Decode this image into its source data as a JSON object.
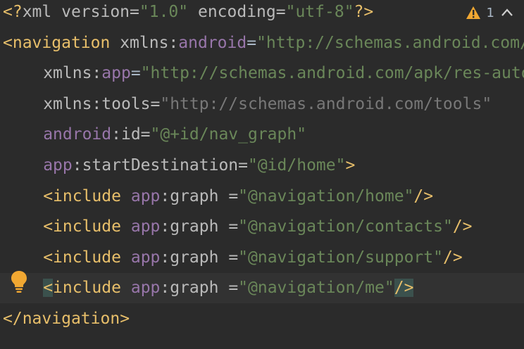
{
  "editor": {
    "lines": [
      {
        "id": "l1",
        "parts": [
          {
            "t": "<?",
            "c": "pi"
          },
          {
            "t": "xml version=",
            "c": "attr"
          },
          {
            "t": "\"1.0\"",
            "c": "val"
          },
          {
            "t": " encoding=",
            "c": "attr"
          },
          {
            "t": "\"utf-8\"",
            "c": "val"
          },
          {
            "t": "?>",
            "c": "pi"
          }
        ]
      },
      {
        "id": "l2",
        "parts": [
          {
            "t": "<",
            "c": "tag-bracket"
          },
          {
            "t": "navigation",
            "c": "tag-name"
          },
          {
            "t": " xmlns:",
            "c": "attr"
          },
          {
            "t": "android",
            "c": "ns"
          },
          {
            "t": "=",
            "c": "eq"
          },
          {
            "t": "\"http://schemas.android.com/apk/res/android\"",
            "c": "val"
          }
        ]
      },
      {
        "id": "l3",
        "indent": 2,
        "parts": [
          {
            "t": "xmlns:",
            "c": "attr"
          },
          {
            "t": "app",
            "c": "ns"
          },
          {
            "t": "=",
            "c": "eq"
          },
          {
            "t": "\"http://schemas.android.com/apk/res-auto\"",
            "c": "val"
          }
        ]
      },
      {
        "id": "l4",
        "indent": 2,
        "muted": true,
        "parts": [
          {
            "t": "xmlns:tools=",
            "c": "attr"
          },
          {
            "t": "\"http://schemas.android.com/tools\"",
            "c": "val"
          }
        ]
      },
      {
        "id": "l5",
        "indent": 2,
        "parts": [
          {
            "t": "android",
            "c": "ns"
          },
          {
            "t": ":id=",
            "c": "attr"
          },
          {
            "t": "\"@+id/nav_graph\"",
            "c": "val"
          }
        ]
      },
      {
        "id": "l6",
        "indent": 2,
        "parts": [
          {
            "t": "app",
            "c": "ns"
          },
          {
            "t": ":startDestination=",
            "c": "attr"
          },
          {
            "t": "\"@id/home\"",
            "c": "val"
          },
          {
            "t": ">",
            "c": "tag-bracket"
          }
        ]
      },
      {
        "id": "l7",
        "indent": 2,
        "parts": [
          {
            "t": "<",
            "c": "tag-bracket"
          },
          {
            "t": "include",
            "c": "tag-name"
          },
          {
            "t": " ",
            "c": "attr"
          },
          {
            "t": "app",
            "c": "ns"
          },
          {
            "t": ":graph =",
            "c": "attr"
          },
          {
            "t": "\"@navigation/home\"",
            "c": "val"
          },
          {
            "t": "/>",
            "c": "tag-bracket"
          }
        ]
      },
      {
        "id": "l8",
        "indent": 2,
        "parts": [
          {
            "t": "<",
            "c": "tag-bracket"
          },
          {
            "t": "include",
            "c": "tag-name"
          },
          {
            "t": " ",
            "c": "attr"
          },
          {
            "t": "app",
            "c": "ns"
          },
          {
            "t": ":graph =",
            "c": "attr"
          },
          {
            "t": "\"@navigation/contacts\"",
            "c": "val"
          },
          {
            "t": "/>",
            "c": "tag-bracket"
          }
        ]
      },
      {
        "id": "l9",
        "indent": 2,
        "parts": [
          {
            "t": "<",
            "c": "tag-bracket"
          },
          {
            "t": "include",
            "c": "tag-name"
          },
          {
            "t": " ",
            "c": "attr"
          },
          {
            "t": "app",
            "c": "ns"
          },
          {
            "t": ":graph =",
            "c": "attr"
          },
          {
            "t": "\"@navigation/support\"",
            "c": "val"
          },
          {
            "t": "/>",
            "c": "tag-bracket"
          }
        ]
      },
      {
        "id": "l10",
        "indent": 2,
        "current": true,
        "parts": [
          {
            "t": "<",
            "c": "hl-bracket"
          },
          {
            "t": "include",
            "c": "tag-name"
          },
          {
            "t": " ",
            "c": "attr"
          },
          {
            "t": "app",
            "c": "ns"
          },
          {
            "t": ":graph =",
            "c": "attr"
          },
          {
            "t": "\"@navigation/me\"",
            "c": "val"
          },
          {
            "t": "/>",
            "c": "hl-bracket"
          }
        ]
      },
      {
        "id": "l11",
        "parts": [
          {
            "t": "</",
            "c": "tag-bracket"
          },
          {
            "t": "navigation",
            "c": "tag-name"
          },
          {
            "t": ">",
            "c": "tag-bracket"
          }
        ]
      }
    ]
  },
  "inspection": {
    "warning_count": "1",
    "icon": "warning-icon",
    "nav_icon": "chevron-up-icon"
  },
  "gutter": {
    "intention_icon": "lightbulb-icon"
  },
  "colors": {
    "background": "#2b2b2b",
    "current_line": "#323232",
    "tag": "#e8bf6a",
    "namespace": "#9876aa",
    "string": "#6a8759",
    "warning": "#f0a732"
  }
}
